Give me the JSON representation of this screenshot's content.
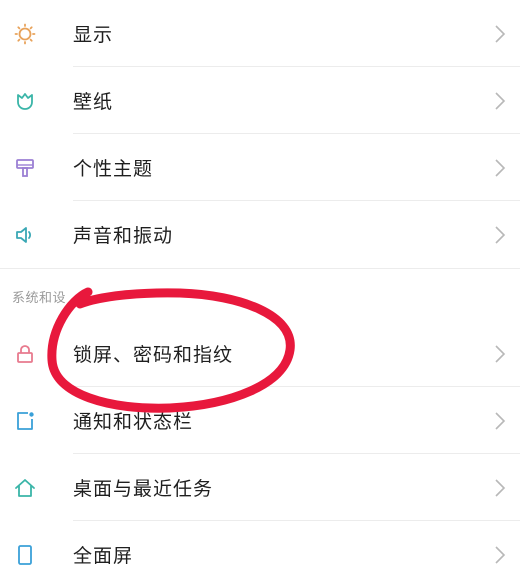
{
  "settings": {
    "items_top": [
      {
        "label": "显示",
        "icon": "sun-icon",
        "color": "#e8a25a"
      },
      {
        "label": "壁纸",
        "icon": "tulip-icon",
        "color": "#3ab5a8"
      },
      {
        "label": "个性主题",
        "icon": "paint-roller-icon",
        "color": "#9b7fd4"
      },
      {
        "label": "声音和振动",
        "icon": "speaker-icon",
        "color": "#3aa8b5"
      }
    ],
    "section_label": "系统和设",
    "items_bottom": [
      {
        "label": "锁屏、密码和指纹",
        "icon": "lock-icon",
        "color": "#e87a8e"
      },
      {
        "label": "通知和状态栏",
        "icon": "notification-icon",
        "color": "#3aa0d8"
      },
      {
        "label": "桌面与最近任务",
        "icon": "home-icon",
        "color": "#3ab5a8"
      },
      {
        "label": "全面屏",
        "icon": "phone-icon",
        "color": "#3aa0d8"
      }
    ]
  },
  "annotation_color": "#e8183c"
}
